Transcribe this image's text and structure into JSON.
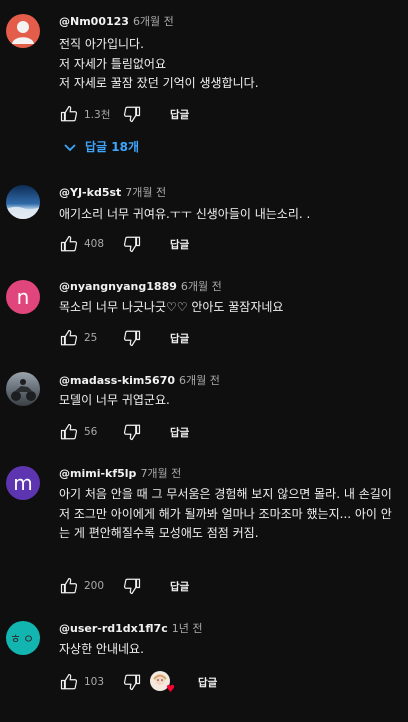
{
  "ui": {
    "reply_label": "답글"
  },
  "comments": [
    {
      "author": "@Nm00123",
      "time": "6개월 전",
      "text": "전직 아가입니다.\n저 자세가 틀림없어요\n저 자세로 꿀잠 잤던 기억이 생생합니다.",
      "likes": "1.3천",
      "avatar_type": "person",
      "avatar_color": "#e35d4a",
      "replies_label": "답글 18개"
    },
    {
      "author": "@YJ-kd5st",
      "time": "7개월 전",
      "text": "애기소리 너무 귀여유.ㅜㅜ 신생아들이 내는소리. .",
      "likes": "408",
      "avatar_type": "sky",
      "avatar_color": "#3b6fa3"
    },
    {
      "author": "@nyangnyang1889",
      "time": "6개월 전",
      "text": "목소리 너무 나긋나긋♡♡ 안아도 꿀잠자네요",
      "likes": "25",
      "avatar_type": "letter",
      "avatar_letter": "n",
      "avatar_color": "#e0457b"
    },
    {
      "author": "@madass-kim5670",
      "time": "6개월 전",
      "text": "모델이 너무 귀엽군요.",
      "likes": "56",
      "avatar_type": "photo",
      "avatar_color": "#5a6470"
    },
    {
      "author": "@mimi-kf5lp",
      "time": "7개월 전",
      "text": "아기 처음 안을 때 그 무서움은 경험해 보지 않으면 몰라. 내 손길이 저 조그만 아이에게 해가 될까봐 얼마나 조마조마 했는지... 아이 안는 게 편안해질수록 모성애도 점점 커짐.",
      "likes": "200",
      "avatar_type": "letter",
      "avatar_letter": "m",
      "avatar_color": "#5e35b1"
    },
    {
      "author": "@user-rd1dx1fl7c",
      "time": "1년 전",
      "text": "자상한 안내네요.",
      "likes": "103",
      "avatar_type": "small",
      "avatar_letter": "ㅎㅇ",
      "avatar_color": "#12b5b0",
      "creator_heart": true
    }
  ]
}
